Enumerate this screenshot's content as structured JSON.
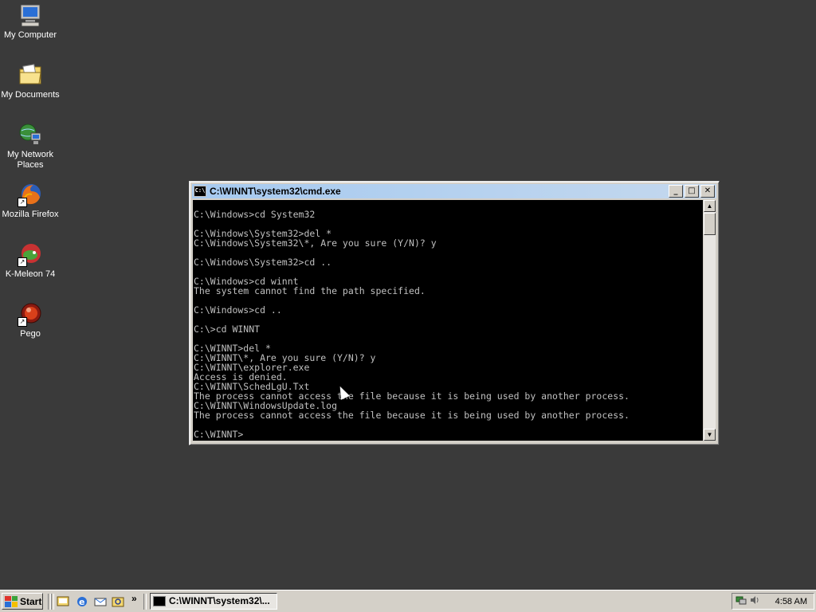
{
  "desktop": {
    "icons": [
      {
        "label": "My Computer"
      },
      {
        "label": "My Documents"
      },
      {
        "label": "My Network Places"
      },
      {
        "label": "Mozilla Firefox"
      },
      {
        "label": "K-Meleon 74"
      },
      {
        "label": "Pego"
      }
    ]
  },
  "window": {
    "title": "C:\\WINNT\\system32\\cmd.exe",
    "icon_text": "C:\\",
    "minimize_glyph": "_",
    "maximize_glyph": "□",
    "close_glyph": "✕",
    "console_lines": [
      "C:\\Windows>cd System32",
      "",
      "C:\\Windows\\System32>del *",
      "C:\\Windows\\System32\\*, Are you sure (Y/N)? y",
      "",
      "C:\\Windows\\System32>cd ..",
      "",
      "C:\\Windows>cd winnt",
      "The system cannot find the path specified.",
      "",
      "C:\\Windows>cd ..",
      "",
      "C:\\>cd WINNT",
      "",
      "C:\\WINNT>del *",
      "C:\\WINNT\\*, Are you sure (Y/N)? y",
      "C:\\WINNT\\explorer.exe",
      "Access is denied.",
      "C:\\WINNT\\SchedLgU.Txt",
      "The process cannot access the file because it is being used by another process.",
      "C:\\WINNT\\WindowsUpdate.log",
      "The process cannot access the file because it is being used by another process.",
      "",
      "C:\\WINNT>"
    ],
    "scroll_up_glyph": "▲",
    "scroll_down_glyph": "▼"
  },
  "taskbar": {
    "start_label": "Start",
    "task_label": "C:\\WINNT\\system32\\...",
    "chevron": "»",
    "clock": "4:58 AM"
  },
  "colors": {
    "desktop_bg": "#3a3a3a",
    "titlebar_active": "#a6caf0",
    "console_bg": "#000000",
    "console_fg": "#c0c0c0"
  },
  "icons": {
    "my_computer": "computer-icon",
    "my_documents": "folder-icon",
    "network": "network-globe-icon",
    "firefox": "firefox-icon",
    "kmeleon": "kmeleon-icon",
    "pego": "pego-icon"
  }
}
